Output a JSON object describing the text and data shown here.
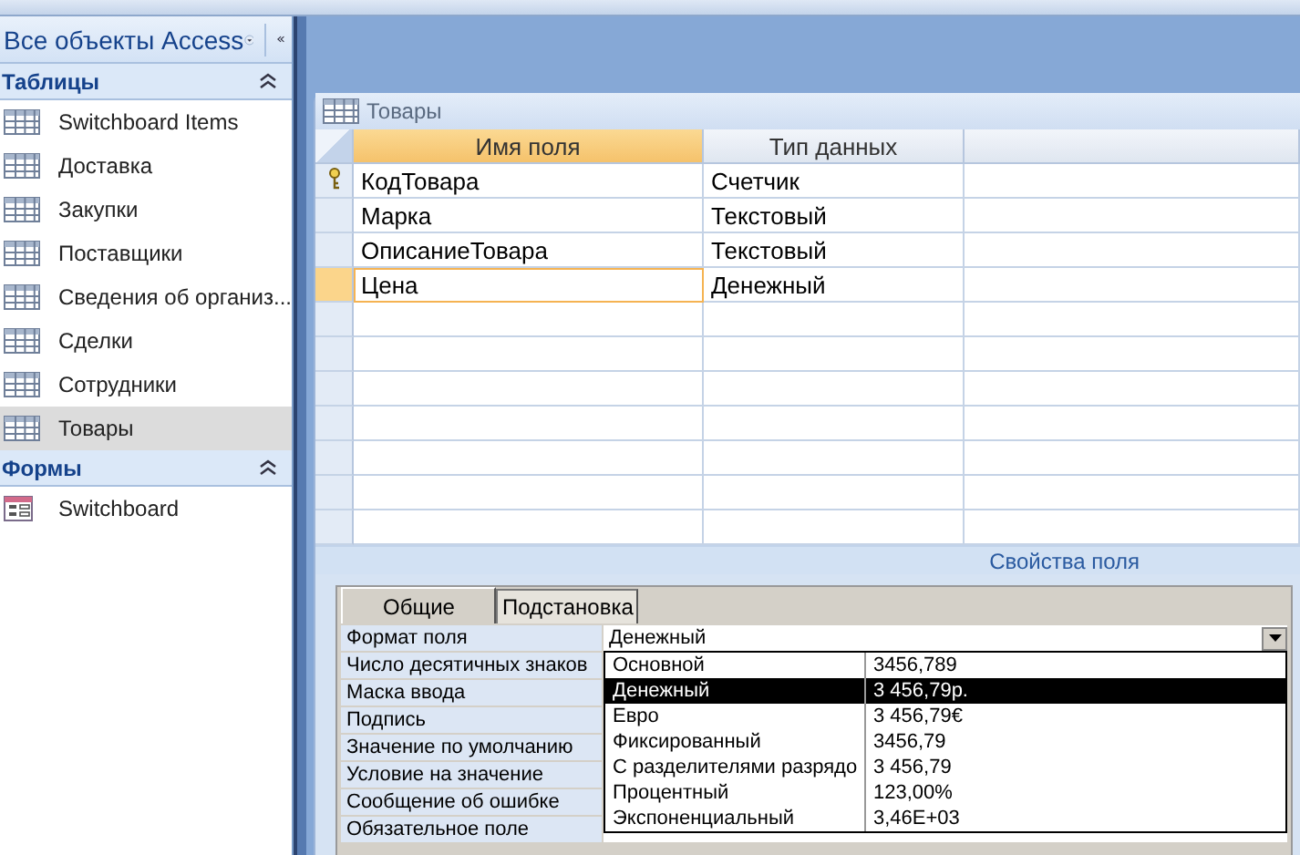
{
  "navigation_pane": {
    "title": "Все объекты Access",
    "groups": [
      {
        "title": "Таблицы",
        "expanded": true,
        "items": [
          {
            "label": "Switchboard Items",
            "kind": "table",
            "selected": false
          },
          {
            "label": "Доставка",
            "kind": "table",
            "selected": false
          },
          {
            "label": "Закупки",
            "kind": "table",
            "selected": false
          },
          {
            "label": "Поставщики",
            "kind": "table",
            "selected": false
          },
          {
            "label": "Сведения об организ...",
            "kind": "table",
            "selected": false
          },
          {
            "label": "Сделки",
            "kind": "table",
            "selected": false
          },
          {
            "label": "Сотрудники",
            "kind": "table",
            "selected": false
          },
          {
            "label": "Товары",
            "kind": "table",
            "selected": true
          }
        ]
      },
      {
        "title": "Формы",
        "expanded": true,
        "items": [
          {
            "label": "Switchboard",
            "kind": "form",
            "selected": false
          }
        ]
      }
    ]
  },
  "document": {
    "title": "Товары",
    "columns": [
      "Имя поля",
      "Тип данных"
    ],
    "rows": [
      {
        "name": "КодТовара",
        "type": "Счетчик",
        "primary_key": true,
        "selected": false
      },
      {
        "name": "Марка",
        "type": "Текстовый",
        "primary_key": false,
        "selected": false
      },
      {
        "name": "ОписаниеТовара",
        "type": "Текстовый",
        "primary_key": false,
        "selected": false
      },
      {
        "name": "Цена",
        "type": "Денежный",
        "primary_key": false,
        "selected": true
      }
    ],
    "properties_caption": "Свойства поля",
    "tabs": [
      {
        "label": "Общие",
        "selected": true
      },
      {
        "label": "Подстановка",
        "selected": false
      }
    ],
    "properties": [
      {
        "label": "Формат поля",
        "value": "Денежный"
      },
      {
        "label": "Число десятичных знаков"
      },
      {
        "label": "Маска ввода"
      },
      {
        "label": "Подпись"
      },
      {
        "label": "Значение по умолчанию"
      },
      {
        "label": "Условие на значение"
      },
      {
        "label": "Сообщение об ошибке"
      },
      {
        "label": "Обязательное поле"
      }
    ],
    "format_options": [
      {
        "name": "Основной",
        "sample": "3456,789",
        "selected": false
      },
      {
        "name": "Денежный",
        "sample": "3 456,79р.",
        "selected": true
      },
      {
        "name": "Евро",
        "sample": "3 456,79€",
        "selected": false
      },
      {
        "name": "Фиксированный",
        "sample": "3456,79",
        "selected": false
      },
      {
        "name": "С разделителями разрядо",
        "sample": "3 456,79",
        "selected": false
      },
      {
        "name": "Процентный",
        "sample": "123,00%",
        "selected": false
      },
      {
        "name": "Экспоненциальный",
        "sample": "3,46E+03",
        "selected": false
      }
    ]
  }
}
